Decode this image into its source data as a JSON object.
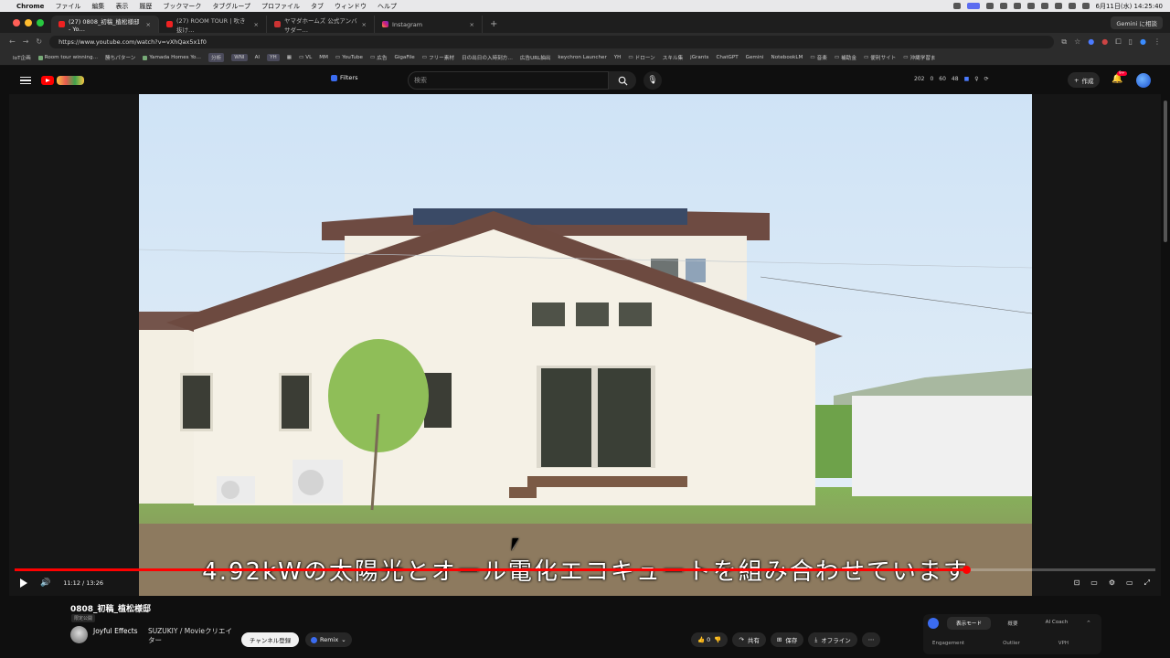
{
  "os_menubar": {
    "app_name": "Chrome",
    "menus": [
      "ファイル",
      "編集",
      "表示",
      "履歴",
      "ブックマーク",
      "タブグループ",
      "プロファイル",
      "タブ",
      "ウィンドウ",
      "ヘルプ"
    ],
    "clock": "6月11日(水) 14:25:40"
  },
  "browser": {
    "tabs": [
      {
        "title": "(27) 0808_初稿_植松様邸 - Yo…",
        "active": true
      },
      {
        "title": "(27) ROOM TOUR | 吹き抜け…",
        "active": false
      },
      {
        "title": "ヤマダホームズ 公式アンバサダー…",
        "active": false
      },
      {
        "title": "Instagram",
        "active": false
      }
    ],
    "gemini_button": "Gemini に相談",
    "url": "https://www.youtube.com/watch?v=vXhQax5x1f0",
    "bookmarks": [
      "IoT企画",
      "Room tour winning…",
      "勝ちパターン",
      "Yamada Homes Yo…",
      "分析",
      "WNI",
      "AI",
      "YH",
      "VL",
      "MM",
      "YouTube",
      "広告",
      "GigaFile",
      "フリー素材",
      "日の出日の入時刻方…",
      "広告URL抽出",
      "keychron Launcher",
      "YH",
      "ドローン",
      "スキル集",
      "jGrants",
      "ChatGPT",
      "Gemini",
      "NotebookLM",
      "音楽",
      "補助金",
      "便利サイト",
      "沖縄学習ま"
    ]
  },
  "youtube_header": {
    "filters_label": "Filters",
    "search_placeholder": "検索",
    "stats": [
      "202",
      "0",
      "60",
      "48"
    ],
    "create_label": "作成",
    "notif_badge": "9+"
  },
  "player": {
    "caption": "4.92kWの太陽光とオール電化エコキュートを組み合わせています",
    "time": "11:12 / 13:26",
    "progress": 0.834
  },
  "video_info": {
    "title": "0808_初稿_植松様邸",
    "visibility": "限定公開",
    "channel_name": "Joyful Effects",
    "channel_extra": "SUZUKIY / Movieクリエイター",
    "subscribe_label": "チャンネル登録",
    "remix_label": "Remix",
    "like_count": "0",
    "share_label": "共有",
    "save_label": "保存",
    "offline_label": "オフライン"
  },
  "side_panel": {
    "segments": [
      "表示モード",
      "概要",
      "AI Coach"
    ],
    "labels": [
      "Engagement",
      "Outlier",
      "VPH"
    ]
  },
  "colors": {
    "accent_red": "#ff0000",
    "brand_blue": "#3b6cf0"
  }
}
